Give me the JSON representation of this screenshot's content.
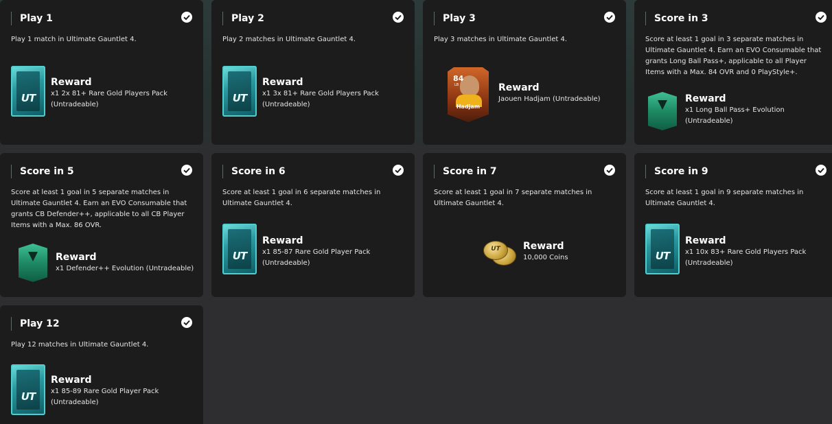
{
  "objectives": [
    {
      "title": "Play 1",
      "description": "Play 1 match in Ultimate Gauntlet 4.",
      "reward_title": "Reward",
      "reward_text": "x1 2x 81+ Rare Gold Players Pack (Untradeable)",
      "reward_type": "pack",
      "completed": true
    },
    {
      "title": "Play 2",
      "description": "Play 2 matches in Ultimate Gauntlet 4.",
      "reward_title": "Reward",
      "reward_text": "x1 3x 81+ Rare Gold Players Pack (Untradeable)",
      "reward_type": "pack",
      "completed": true
    },
    {
      "title": "Play 3",
      "description": "Play 3 matches in Ultimate Gauntlet 4.",
      "reward_title": "Reward",
      "reward_text": "Jaouen Hadjam (Untradeable)",
      "reward_type": "player",
      "player": {
        "rating": "84",
        "position": "LB",
        "name": "Hadjam"
      },
      "completed": true
    },
    {
      "title": "Score in 3",
      "description": "Score at least 1 goal in 3 separate matches in Ultimate Gauntlet 4. Earn an EVO Consumable that grants Long Ball Pass+, applicable to all Player Items with a Max. 84 OVR and 0 PlayStyle+.",
      "reward_title": "Reward",
      "reward_text": "x1 Long Ball Pass+ Evolution (Untradeable)",
      "reward_type": "evolution",
      "completed": true
    },
    {
      "title": "Score in 5",
      "description": "Score at least 1 goal in 5 separate matches in Ultimate Gauntlet 4. Earn an EVO Consumable that grants CB Defender++, applicable to all CB Player Items with a Max. 86 OVR.",
      "reward_title": "Reward",
      "reward_text": "x1 Defender++ Evolution (Untradeable)",
      "reward_type": "evolution",
      "completed": true
    },
    {
      "title": "Score in 6",
      "description": "Score at least 1 goal in 6 separate matches in Ultimate Gauntlet 4.",
      "reward_title": "Reward",
      "reward_text": "x1 85-87 Rare Gold Player Pack (Untradeable)",
      "reward_type": "pack",
      "completed": true
    },
    {
      "title": "Score in 7",
      "description": "Score at least 1 goal in 7 separate matches in Ultimate Gauntlet 4.",
      "reward_title": "Reward",
      "reward_text": "10,000 Coins",
      "reward_type": "coins",
      "completed": true
    },
    {
      "title": "Score in 9",
      "description": "Score at least 1 goal in 9 separate matches in Ultimate Gauntlet 4.",
      "reward_title": "Reward",
      "reward_text": "x1 10x 83+ Rare Gold Players Pack (Untradeable)",
      "reward_type": "pack",
      "completed": true
    },
    {
      "title": "Play 12",
      "description": "Play 12 matches in Ultimate Gauntlet 4.",
      "reward_title": "Reward",
      "reward_text": "x1 85-89 Rare Gold Player Pack (Untradeable)",
      "reward_type": "pack",
      "completed": true
    }
  ],
  "icons": {
    "pack": "ut-pack-icon",
    "evolution": "evolution-icon",
    "coins": "coins-icon",
    "player": "player-card",
    "check": "check-circle-icon"
  },
  "colors": {
    "card_bg": "#1c1c1d",
    "page_bg": "#2e2e30",
    "pack_accent": "#4fcfd0",
    "evo_accent": "#3fbf95",
    "player_card": "#d0672a"
  }
}
